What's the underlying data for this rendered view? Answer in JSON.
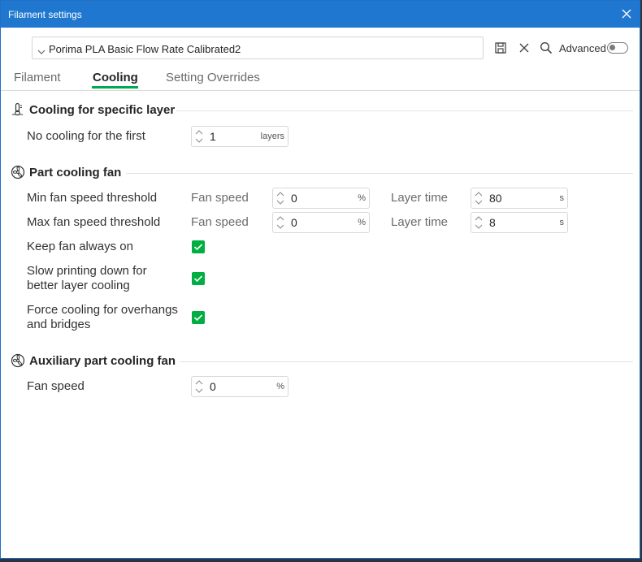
{
  "window": {
    "title": "Filament settings"
  },
  "preset": {
    "name": "Porima PLA Basic Flow Rate Calibrated2"
  },
  "toolbar": {
    "advanced_label": "Advanced",
    "advanced_on": false
  },
  "tabs": [
    {
      "label": "Filament",
      "active": false
    },
    {
      "label": "Cooling",
      "active": true
    },
    {
      "label": "Setting Overrides",
      "active": false
    }
  ],
  "cooling_layer": {
    "title": "Cooling for specific layer",
    "no_cooling_label": "No cooling for the first",
    "no_cooling_value": "1",
    "no_cooling_unit": "layers"
  },
  "part_fan": {
    "title": "Part cooling fan",
    "min_label": "Min fan speed threshold",
    "max_label": "Max fan speed threshold",
    "fan_speed_label": "Fan speed",
    "layer_time_label": "Layer time",
    "min_fan_speed": "0",
    "min_layer_time": "80",
    "max_fan_speed": "0",
    "max_layer_time": "8",
    "percent_unit": "%",
    "seconds_unit": "s",
    "keep_fan_label": "Keep fan always on",
    "keep_fan_checked": true,
    "slow_label_1": "Slow printing down for",
    "slow_label_2": "better layer cooling",
    "slow_checked": true,
    "force_label_1": "Force cooling for overhangs",
    "force_label_2": "and bridges",
    "force_checked": true
  },
  "aux_fan": {
    "title": "Auxiliary part cooling fan",
    "fan_speed_label": "Fan speed",
    "fan_speed_value": "0",
    "unit": "%"
  },
  "colors": {
    "accent": "#00ae42",
    "titlebar": "#1f77d0"
  }
}
